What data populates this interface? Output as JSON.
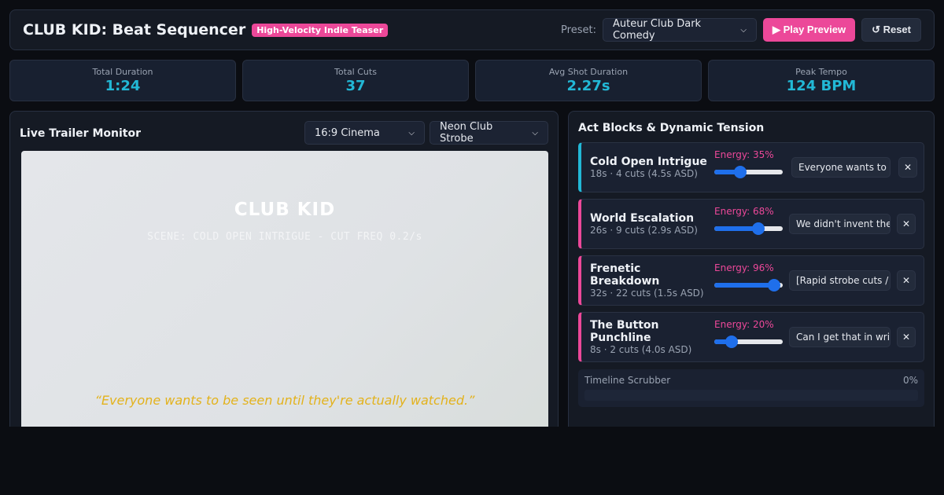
{
  "header": {
    "title": "CLUB KID: Beat Sequencer",
    "badge": "High-Velocity Indie Teaser",
    "preset_label": "Preset:",
    "preset_value": "Auteur Club Dark Comedy",
    "play_label": "▶ Play Preview",
    "reset_label": "↺ Reset"
  },
  "stats": [
    {
      "label": "Total Duration",
      "value": "1:24"
    },
    {
      "label": "Total Cuts",
      "value": "37"
    },
    {
      "label": "Avg Shot Duration",
      "value": "2.27s"
    },
    {
      "label": "Peak Tempo",
      "value": "124 BPM"
    }
  ],
  "monitor": {
    "title": "Live Trailer Monitor",
    "aspect_value": "16:9 Cinema",
    "style_value": "Neon Club Strobe",
    "screen_title": "CLUB KID",
    "scene_line": "SCENE: COLD OPEN INTRIGUE - CUT FREQ 0.2/s",
    "quote": "“Everyone wants to be seen until they're actually watched.”"
  },
  "acts": {
    "title": "Act Blocks & Dynamic Tension",
    "items": [
      {
        "name": "Cold Open Intrigue",
        "meta": "18s · 4 cuts (4.5s ASD)",
        "energy_label": "Energy: 35%",
        "energy": 0.35,
        "line": "Everyone wants to be seen",
        "close": "✕"
      },
      {
        "name": "World Escalation",
        "meta": "26s · 9 cuts (2.9s ASD)",
        "energy_label": "Energy: 68%",
        "energy": 0.68,
        "line": "We didn't invent the rules",
        "close": "✕"
      },
      {
        "name": "Frenetic Breakdown",
        "meta": "32s · 22 cuts (1.5s ASD)",
        "energy_label": "Energy: 96%",
        "energy": 0.96,
        "line": "[Rapid strobe cuts / bass drop]",
        "close": "✕"
      },
      {
        "name": "The Button Punchline",
        "meta": "8s · 2 cuts (4.0s ASD)",
        "energy_label": "Energy: 20%",
        "energy": 0.2,
        "line": "Can I get that in writing?",
        "close": "✕"
      }
    ]
  },
  "scrubber": {
    "label": "Timeline Scrubber",
    "percent_label": "0%",
    "progress": 0
  },
  "colors": {
    "accent_pink": "#ec4899",
    "accent_cyan": "#22b8d6",
    "slider_blue": "#1f6feb",
    "quote_gold": "#e3b21c"
  },
  "icons": {
    "play": "play-icon",
    "reset": "reset-icon",
    "close": "close-icon",
    "dropdown": "chevron-down-icon"
  }
}
